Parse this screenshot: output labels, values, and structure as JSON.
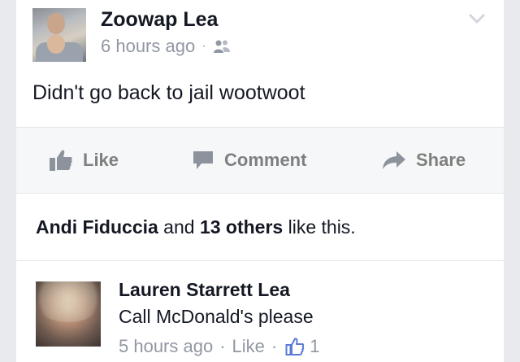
{
  "post": {
    "author": "Zoowap Lea",
    "time": "6 hours ago",
    "dot": "·",
    "privacy_icon": "friends-icon",
    "text": "Didn't go back to jail wootwoot"
  },
  "actions": {
    "like": "Like",
    "comment": "Comment",
    "share": "Share"
  },
  "likes_summary": {
    "name": "Andi Fiduccia",
    "and": " and ",
    "others": "13 others",
    "suffix": " like this."
  },
  "comment": {
    "author": "Lauren Starrett Lea",
    "text": "Call McDonald's please",
    "time": "5 hours ago",
    "sep": "·",
    "like": "Like",
    "like_count": "1"
  },
  "colors": {
    "text": "#141823",
    "meta": "#9197a3",
    "action": "#7f7f7f"
  }
}
